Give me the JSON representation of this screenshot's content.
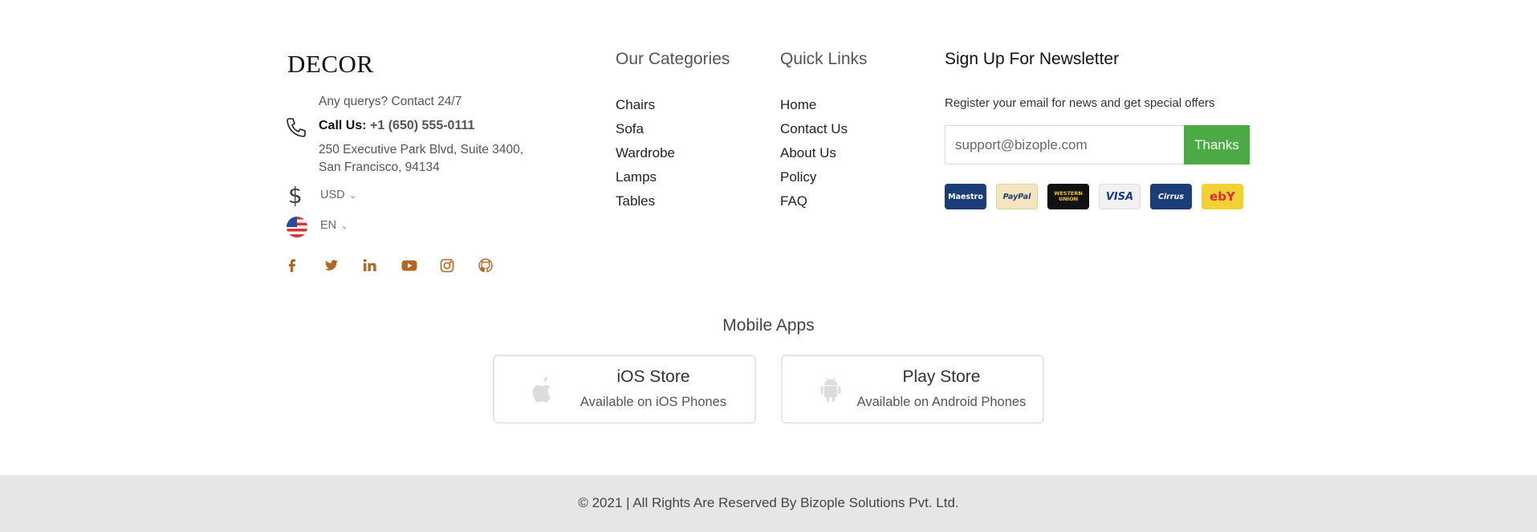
{
  "brand": {
    "logo_text": "DECOR"
  },
  "contact": {
    "note": "Any querys? Contact 24/7",
    "call_label": "Call Us:",
    "phone": "+1 (650) 555-0111",
    "address_line1": "250 Executive Park Blvd, Suite 3400,",
    "address_line2": "San Francisco, 94134"
  },
  "selectors": {
    "currency": "USD",
    "language": "EN"
  },
  "social": [
    "facebook-icon",
    "twitter-icon",
    "linkedin-icon",
    "youtube-icon",
    "instagram-icon",
    "github-icon"
  ],
  "categories": {
    "title": "Our Categories",
    "items": [
      "Chairs",
      "Sofa",
      "Wardrobe",
      "Lamps",
      "Tables"
    ]
  },
  "quick_links": {
    "title": "Quick Links",
    "items": [
      "Home",
      "Contact Us",
      "About Us",
      "Policy",
      "FAQ"
    ]
  },
  "newsletter": {
    "title": "Sign Up For Newsletter",
    "note": "Register your email for news and get special offers",
    "placeholder": "support@bizople.com",
    "button": "Thanks"
  },
  "payment_cards": [
    "Maestro",
    "PayPal",
    "WESTERN UNION",
    "VISA",
    "Cirrus",
    "ebY"
  ],
  "mobile_apps": {
    "title": "Mobile Apps",
    "ios": {
      "name": "iOS Store",
      "sub": "Available on iOS Phones"
    },
    "play": {
      "name": "Play Store",
      "sub": "Available on Android Phones"
    }
  },
  "footer": {
    "copyright": "© 2021 | All Rights Are Reserved By Bizople Solutions Pvt. Ltd."
  },
  "colors": {
    "accent": "#b5651d",
    "button_green": "#4caa45",
    "bottom_bar": "#e6e6e6"
  }
}
